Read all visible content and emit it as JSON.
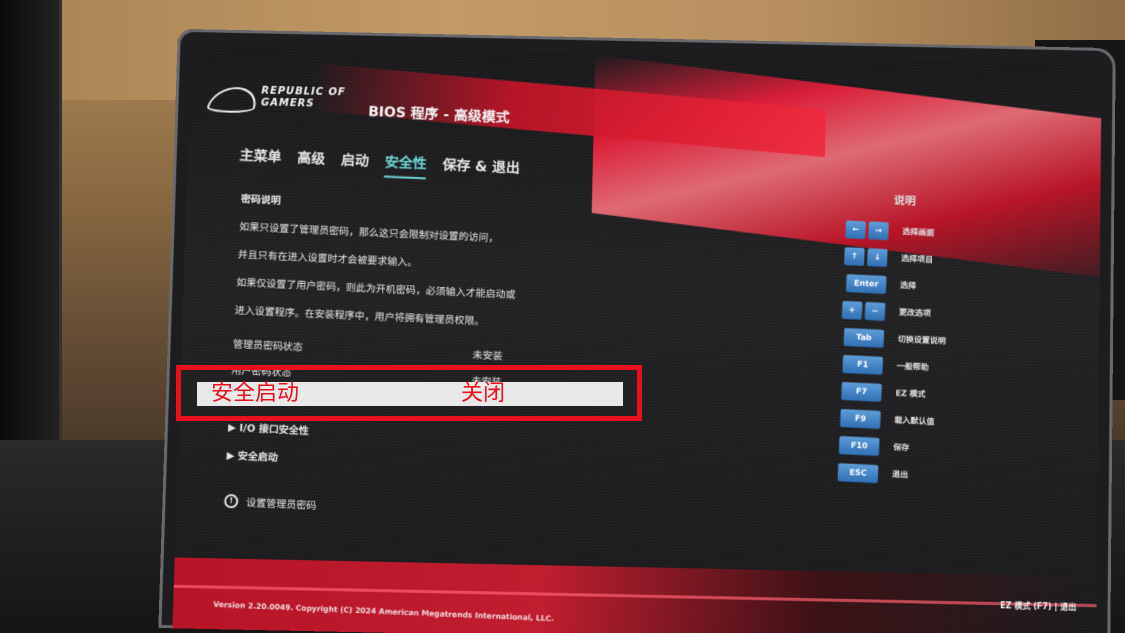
{
  "header": {
    "logo_text": "REPUBLIC OF GAMERS",
    "title": "BIOS 程序 - 高级模式"
  },
  "tabs": [
    {
      "label": "主菜单"
    },
    {
      "label": "高级"
    },
    {
      "label": "启动"
    },
    {
      "label": "安全性",
      "active": true
    },
    {
      "label": "保存 & 退出"
    }
  ],
  "security": {
    "heading": "密码说明",
    "desc": [
      "如果只设置了管理员密码，那么这只会限制对设置的访问，",
      "并且只有在进入设置时才会被要求输入。",
      "如果仅设置了用户密码，则此为开机密码，必须输入才能启动或",
      "进入设置程序。在安装程序中，用户将拥有管理员权限。"
    ],
    "admin_status_label": "管理员密码状态",
    "admin_status_value": "未安装",
    "user_status_label": "用户密码状态",
    "user_status_value": "未安装",
    "submenus": [
      {
        "label": "▶ I/O 接口安全性"
      },
      {
        "label": "▶ 安全启动"
      }
    ],
    "info_text": "设置管理员密码"
  },
  "highlight": {
    "label": "安全启动",
    "value": "关闭"
  },
  "help_panel": {
    "title": "说明",
    "items": [
      {
        "keys": [
          "←",
          "→"
        ],
        "label": "选择画面"
      },
      {
        "keys": [
          "↑",
          "↓"
        ],
        "label": "选择项目"
      },
      {
        "keys": [
          "Enter"
        ],
        "label": "选择"
      },
      {
        "keys": [
          "+",
          "−"
        ],
        "label": "更改选项"
      },
      {
        "keys": [
          "Tab"
        ],
        "label": "切换设置说明"
      },
      {
        "keys": [
          "F1"
        ],
        "label": "一般帮助"
      },
      {
        "keys": [
          "F7"
        ],
        "label": "EZ 模式"
      },
      {
        "keys": [
          "F9"
        ],
        "label": "载入默认值"
      },
      {
        "keys": [
          "F10"
        ],
        "label": "保存"
      },
      {
        "keys": [
          "ESC"
        ],
        "label": "退出"
      }
    ]
  },
  "footer": {
    "version": "Version 2.20.0049. Copyright (C) 2024 American Megatrends International, LLC.",
    "right": "EZ 模式 (F7) | 退出"
  },
  "colors": {
    "accent_red": "#e8101c",
    "active_tab": "#6fd6d8",
    "key_blue": "#3a7ec4"
  }
}
